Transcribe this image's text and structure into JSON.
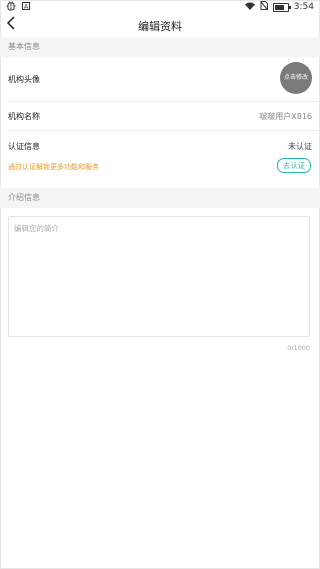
{
  "status_bar": {
    "left_icons": [
      "bug-icon",
      "a-notification-icon"
    ],
    "time": "3:54",
    "right_icons": [
      "wifi-icon",
      "no-sim-icon",
      "battery-icon"
    ],
    "battery_level": 0.75
  },
  "header": {
    "back_icon": "chevron-left-icon",
    "title": "编辑资料"
  },
  "basic_info": {
    "section_title": "基本信息",
    "avatar_label": "机构头像",
    "avatar_button": "点击修改",
    "name_label": "机构名称",
    "name_value": "啵啵用户X816",
    "certification_label": "认证信息",
    "certification_status": "未认证",
    "certification_hint": "通过认证解锁更多功能和服务",
    "certification_button": "去认证"
  },
  "intro": {
    "section_title": "介绍信息",
    "placeholder": "编辑您的简介",
    "value": "",
    "counter": "0/1000"
  },
  "colors": {
    "accent_teal": "#2bb7b0",
    "hint_orange": "#e89b1c",
    "section_bg": "#f5f5f5"
  }
}
